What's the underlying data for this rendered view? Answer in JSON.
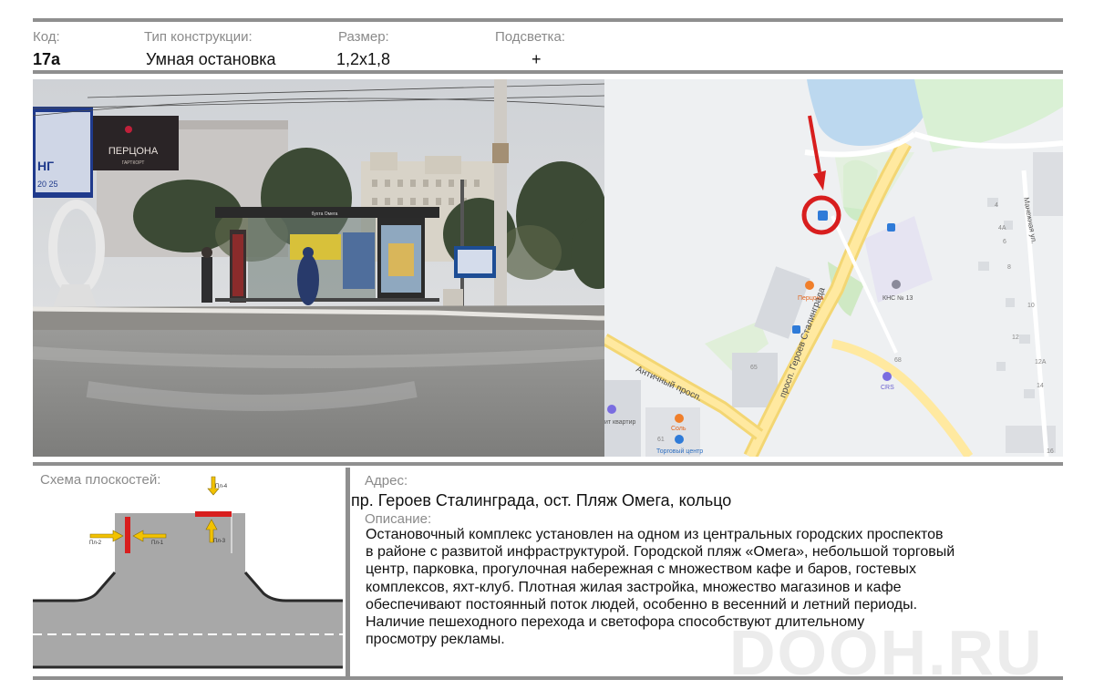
{
  "header": {
    "code_label": "Код:",
    "code_value": "17а",
    "type_label": "Тип конструкции:",
    "type_value": "Умная остановка",
    "size_label": "Размер:",
    "size_value": "1,2х1,8",
    "light_label": "Подсветка:",
    "light_value": "+"
  },
  "photo": {
    "billboard_brand": "ПЕРЦОНА",
    "billboard_sub": "ГАРТКОРТ",
    "billboard_text_left": "НГ",
    "billboard_phone": "20 25",
    "shelter_sign": "бухта Омега"
  },
  "map": {
    "street_main": "просп. Героев Сталинграда",
    "street_antique": "Античный просп.",
    "street_maneschnaya": "Манежная ул.",
    "poi_pertsona": "Перцона",
    "poi_kns": "КНС № 13",
    "poi_crs": "CRS",
    "poi_sol": "Соль",
    "poi_mall": "Торговый центр",
    "poi_kvartir": "ит квартир",
    "house_65": "65",
    "house_61": "61",
    "house_4": "4",
    "house_4a": "4А",
    "house_6": "6",
    "house_8": "8",
    "house_10": "10",
    "house_12": "12",
    "house_12a": "12А",
    "house_14": "14",
    "house_16": "16",
    "house_68": "68",
    "bus_icon": "bus-stop-icon",
    "accent_red": "#d81e1e"
  },
  "scheme": {
    "title": "Схема плоскостей:",
    "pl1": "Пл-1",
    "pl2": "Пл-2",
    "pl3": "Пл-3",
    "pl4": "Пл-4",
    "arrow_color": "#f2c200",
    "panel_color": "#d81e1e"
  },
  "info": {
    "address_label": "Адрес:",
    "address": "пр. Героев Сталинграда, ост. Пляж Омега, кольцо",
    "description_label": "Описание:",
    "description_lines": [
      "Остановочный комплекс установлен на одном из центральных городских проспектов",
      "в районе с развитой инфраструктурой. Городской пляж «Омега», небольшой торговый",
      "центр, парковка, прогулочная набережная с множеством кафе и баров, гостевых",
      "комплексов, яхт-клуб. Плотная жилая застройка, множество магазинов и кафе",
      "обеспечивают постоянный поток людей, особенно в весенний и летний периоды.",
      "Наличие пешеходного перехода и светофора способствуют длительному",
      "просмотру рекламы."
    ]
  },
  "watermark": "DOOH.RU"
}
